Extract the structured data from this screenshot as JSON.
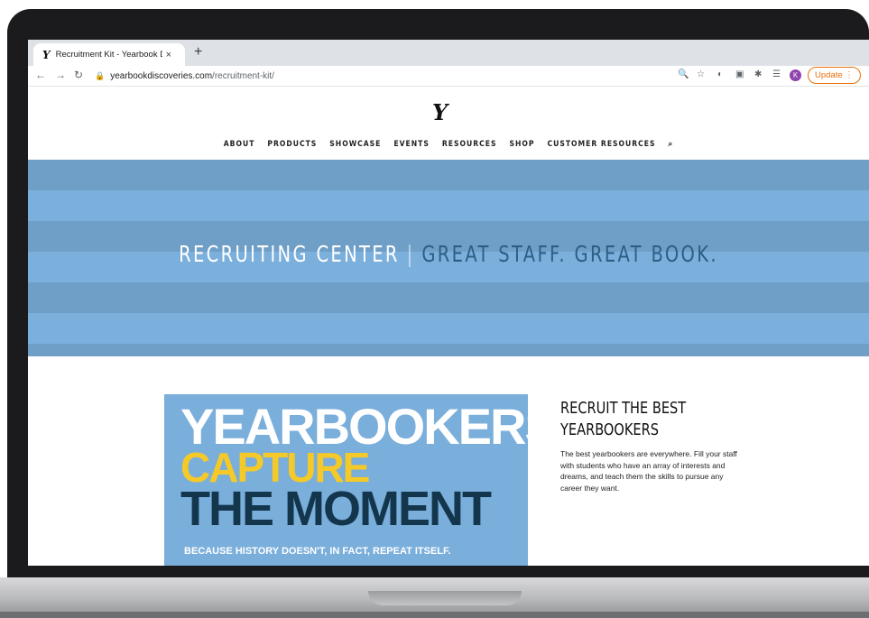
{
  "browser": {
    "tab_title": "Recruitment Kit - Yearbook Dis",
    "tab_close": "×",
    "new_tab": "+",
    "url_host": "yearbookdiscoveries.com",
    "url_path": "/recruitment-kit/",
    "profile_initial": "K",
    "update_label": "Update",
    "update_color": "#e8710a",
    "icons": [
      "back-icon",
      "forward-icon",
      "reload-icon",
      "lock-icon",
      "zoom-icon",
      "star-icon",
      "extension-icon",
      "puzzle-icon",
      "playlist-icon",
      "profile-avatar",
      "menu-icon"
    ]
  },
  "site": {
    "logo": "Y",
    "nav": [
      "ABOUT",
      "PRODUCTS",
      "SHOWCASE",
      "EVENTS",
      "RESOURCES",
      "SHOP",
      "CUSTOMER RESOURCES"
    ],
    "hero": {
      "left": "RECRUITING CENTER",
      "separator": "|",
      "right": "GREAT STAFF. GREAT BOOK.",
      "bg_color": "#7bb0dd"
    },
    "promo": {
      "line1": "YEARBOOKERS",
      "line2": "CAPTURE",
      "line3": "THE MOMENT",
      "tagline": "BECAUSE HISTORY DOESN'T, IN FACT, REPEAT ITSELF.",
      "yellow": "#f5c928",
      "navy": "#14364d"
    },
    "recruit": {
      "heading": "RECRUIT THE BEST YEARBOOKERS",
      "body": "The best yearbookers are everywhere. Fill your staff with students who have an array of interests and dreams, and teach them the skills to pursue any career they want."
    }
  }
}
